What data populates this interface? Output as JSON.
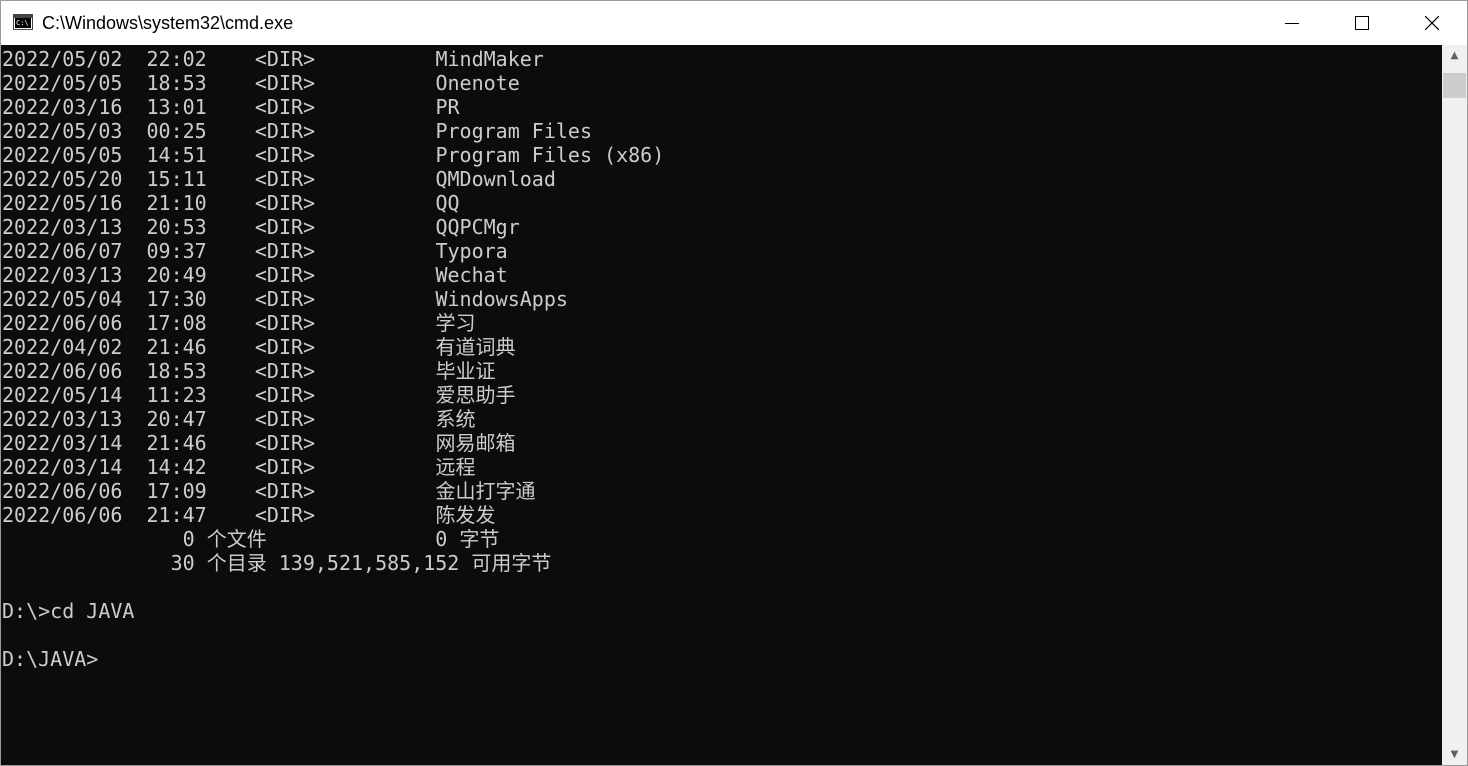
{
  "window": {
    "title": "C:\\Windows\\system32\\cmd.exe",
    "icon": "cmd-icon",
    "icon_text": "C:\\",
    "buttons": {
      "minimize": "minimize-icon",
      "maximize": "maximize-icon",
      "close": "close-icon"
    }
  },
  "colors": {
    "console_bg": "#0c0c0c",
    "console_fg": "#cccccc",
    "titlebar_bg": "#ffffff",
    "scrollbar_bg": "#f0f0f0",
    "scrollbar_thumb": "#cdcdcd"
  },
  "console": {
    "lines": [
      "2022/05/02  22:02    <DIR>          MindMaker",
      "2022/05/05  18:53    <DIR>          Onenote",
      "2022/03/16  13:01    <DIR>          PR",
      "2022/05/03  00:25    <DIR>          Program Files",
      "2022/05/05  14:51    <DIR>          Program Files (x86)",
      "2022/05/20  15:11    <DIR>          QMDownload",
      "2022/05/16  21:10    <DIR>          QQ",
      "2022/03/13  20:53    <DIR>          QQPCMgr",
      "2022/06/07  09:37    <DIR>          Typora",
      "2022/03/13  20:49    <DIR>          Wechat",
      "2022/05/04  17:30    <DIR>          WindowsApps",
      "2022/06/06  17:08    <DIR>          学习",
      "2022/04/02  21:46    <DIR>          有道词典",
      "2022/06/06  18:53    <DIR>          毕业证",
      "2022/05/14  11:23    <DIR>          爱思助手",
      "2022/03/13  20:47    <DIR>          系统",
      "2022/03/14  21:46    <DIR>          网易邮箱",
      "2022/03/14  14:42    <DIR>          远程",
      "2022/06/06  17:09    <DIR>          金山打字通",
      "2022/06/06  21:47    <DIR>          陈发发",
      "               0 个文件              0 字节",
      "              30 个目录 139,521,585,152 可用字节",
      "",
      "D:\\>cd JAVA",
      "",
      "D:\\JAVA>"
    ]
  },
  "scrollbar": {
    "up_icon": "scroll-up-arrow-icon",
    "down_icon": "scroll-down-arrow-icon",
    "up_glyph": "▲",
    "down_glyph": "▼"
  }
}
